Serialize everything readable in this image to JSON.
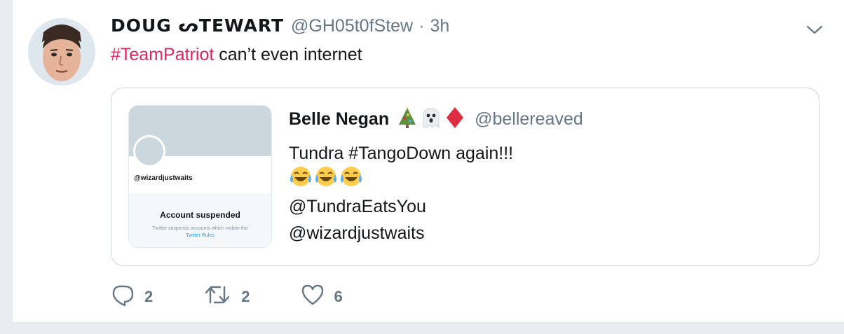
{
  "tweet": {
    "author": {
      "display_name": "DOUG ᔕTEWART",
      "handle": "@GH05t0fStew",
      "separator": "·",
      "time": "3h"
    },
    "text": {
      "hashtag": "#TeamPatriot",
      "rest": " can’t even internet"
    },
    "quoted": {
      "display_name": "Belle Negan",
      "name_emoji": [
        "christmas-tree",
        "ghost",
        "diamond-suit"
      ],
      "handle": "@bellereaved",
      "lines": {
        "line1": "Tundra #TangoDown again!!!",
        "line2_emoji": [
          "tears-of-joy",
          "tears-of-joy",
          "tears-of-joy"
        ],
        "line3": "@TundraEatsYou",
        "line4": "@wizardjustwaits"
      },
      "card": {
        "handle": "@wizardjustwaits",
        "title": "Account suspended",
        "description": "Twitter suspends accounts which violate the",
        "link": "Twitter Rules"
      }
    },
    "actions": {
      "replies": "2",
      "retweets": "2",
      "likes": "6"
    },
    "colors": {
      "hashtag": "#e0245e",
      "secondary_text": "#657786",
      "link": "#1da1f2",
      "border": "#ccd6dd"
    }
  }
}
